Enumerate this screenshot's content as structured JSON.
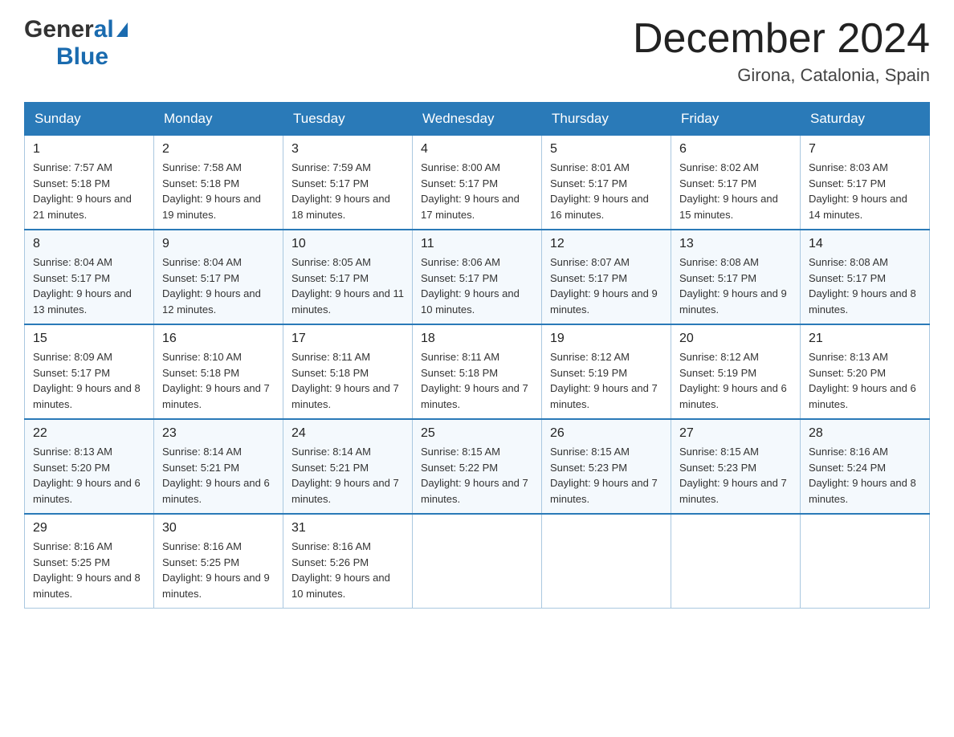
{
  "header": {
    "logo_general": "General",
    "logo_blue": "Blue",
    "month_title": "December 2024",
    "location": "Girona, Catalonia, Spain"
  },
  "weekdays": [
    "Sunday",
    "Monday",
    "Tuesday",
    "Wednesday",
    "Thursday",
    "Friday",
    "Saturday"
  ],
  "weeks": [
    [
      {
        "day": "1",
        "sunrise": "7:57 AM",
        "sunset": "5:18 PM",
        "daylight": "9 hours and 21 minutes."
      },
      {
        "day": "2",
        "sunrise": "7:58 AM",
        "sunset": "5:18 PM",
        "daylight": "9 hours and 19 minutes."
      },
      {
        "day": "3",
        "sunrise": "7:59 AM",
        "sunset": "5:17 PM",
        "daylight": "9 hours and 18 minutes."
      },
      {
        "day": "4",
        "sunrise": "8:00 AM",
        "sunset": "5:17 PM",
        "daylight": "9 hours and 17 minutes."
      },
      {
        "day": "5",
        "sunrise": "8:01 AM",
        "sunset": "5:17 PM",
        "daylight": "9 hours and 16 minutes."
      },
      {
        "day": "6",
        "sunrise": "8:02 AM",
        "sunset": "5:17 PM",
        "daylight": "9 hours and 15 minutes."
      },
      {
        "day": "7",
        "sunrise": "8:03 AM",
        "sunset": "5:17 PM",
        "daylight": "9 hours and 14 minutes."
      }
    ],
    [
      {
        "day": "8",
        "sunrise": "8:04 AM",
        "sunset": "5:17 PM",
        "daylight": "9 hours and 13 minutes."
      },
      {
        "day": "9",
        "sunrise": "8:04 AM",
        "sunset": "5:17 PM",
        "daylight": "9 hours and 12 minutes."
      },
      {
        "day": "10",
        "sunrise": "8:05 AM",
        "sunset": "5:17 PM",
        "daylight": "9 hours and 11 minutes."
      },
      {
        "day": "11",
        "sunrise": "8:06 AM",
        "sunset": "5:17 PM",
        "daylight": "9 hours and 10 minutes."
      },
      {
        "day": "12",
        "sunrise": "8:07 AM",
        "sunset": "5:17 PM",
        "daylight": "9 hours and 9 minutes."
      },
      {
        "day": "13",
        "sunrise": "8:08 AM",
        "sunset": "5:17 PM",
        "daylight": "9 hours and 9 minutes."
      },
      {
        "day": "14",
        "sunrise": "8:08 AM",
        "sunset": "5:17 PM",
        "daylight": "9 hours and 8 minutes."
      }
    ],
    [
      {
        "day": "15",
        "sunrise": "8:09 AM",
        "sunset": "5:17 PM",
        "daylight": "9 hours and 8 minutes."
      },
      {
        "day": "16",
        "sunrise": "8:10 AM",
        "sunset": "5:18 PM",
        "daylight": "9 hours and 7 minutes."
      },
      {
        "day": "17",
        "sunrise": "8:11 AM",
        "sunset": "5:18 PM",
        "daylight": "9 hours and 7 minutes."
      },
      {
        "day": "18",
        "sunrise": "8:11 AM",
        "sunset": "5:18 PM",
        "daylight": "9 hours and 7 minutes."
      },
      {
        "day": "19",
        "sunrise": "8:12 AM",
        "sunset": "5:19 PM",
        "daylight": "9 hours and 7 minutes."
      },
      {
        "day": "20",
        "sunrise": "8:12 AM",
        "sunset": "5:19 PM",
        "daylight": "9 hours and 6 minutes."
      },
      {
        "day": "21",
        "sunrise": "8:13 AM",
        "sunset": "5:20 PM",
        "daylight": "9 hours and 6 minutes."
      }
    ],
    [
      {
        "day": "22",
        "sunrise": "8:13 AM",
        "sunset": "5:20 PM",
        "daylight": "9 hours and 6 minutes."
      },
      {
        "day": "23",
        "sunrise": "8:14 AM",
        "sunset": "5:21 PM",
        "daylight": "9 hours and 6 minutes."
      },
      {
        "day": "24",
        "sunrise": "8:14 AM",
        "sunset": "5:21 PM",
        "daylight": "9 hours and 7 minutes."
      },
      {
        "day": "25",
        "sunrise": "8:15 AM",
        "sunset": "5:22 PM",
        "daylight": "9 hours and 7 minutes."
      },
      {
        "day": "26",
        "sunrise": "8:15 AM",
        "sunset": "5:23 PM",
        "daylight": "9 hours and 7 minutes."
      },
      {
        "day": "27",
        "sunrise": "8:15 AM",
        "sunset": "5:23 PM",
        "daylight": "9 hours and 7 minutes."
      },
      {
        "day": "28",
        "sunrise": "8:16 AM",
        "sunset": "5:24 PM",
        "daylight": "9 hours and 8 minutes."
      }
    ],
    [
      {
        "day": "29",
        "sunrise": "8:16 AM",
        "sunset": "5:25 PM",
        "daylight": "9 hours and 8 minutes."
      },
      {
        "day": "30",
        "sunrise": "8:16 AM",
        "sunset": "5:25 PM",
        "daylight": "9 hours and 9 minutes."
      },
      {
        "day": "31",
        "sunrise": "8:16 AM",
        "sunset": "5:26 PM",
        "daylight": "9 hours and 10 minutes."
      },
      null,
      null,
      null,
      null
    ]
  ]
}
